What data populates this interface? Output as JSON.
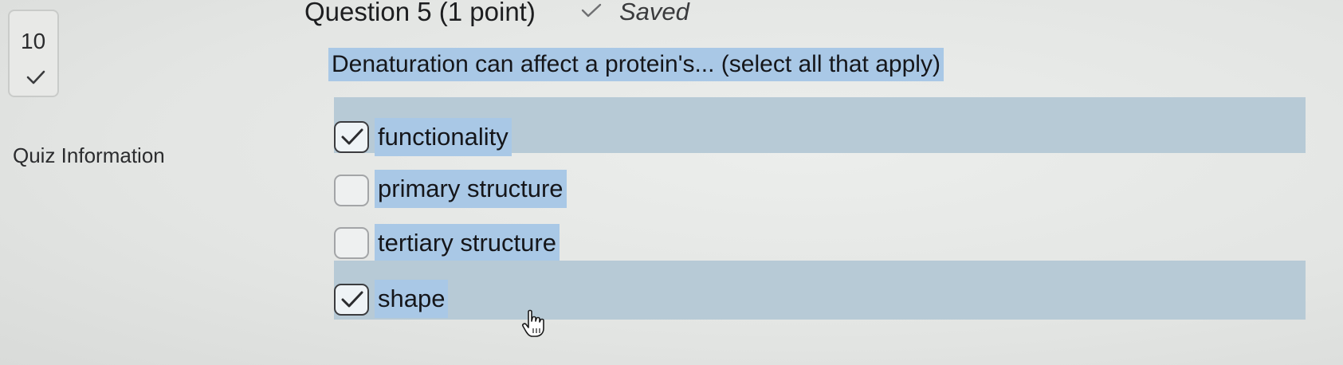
{
  "question_nav": {
    "number": "10",
    "status_icon": "check-icon"
  },
  "sidebar": {
    "quiz_info_label": "Quiz Information"
  },
  "header": {
    "question_title": "Question 5 (1 point)",
    "saved_icon": "check-icon",
    "saved_label": "Saved"
  },
  "question": {
    "text": "Denaturation can affect a protein's... (select all that apply)"
  },
  "answers": [
    {
      "label": "functionality",
      "checked": true
    },
    {
      "label": "primary structure",
      "checked": false
    },
    {
      "label": "tertiary structure",
      "checked": false
    },
    {
      "label": "shape",
      "checked": true
    }
  ],
  "colors": {
    "text_highlight": "#a9c8e6",
    "selected_row": "#b7cad6",
    "background": "#e6e7e5"
  },
  "cursor_icon": "hand-pointer-icon"
}
